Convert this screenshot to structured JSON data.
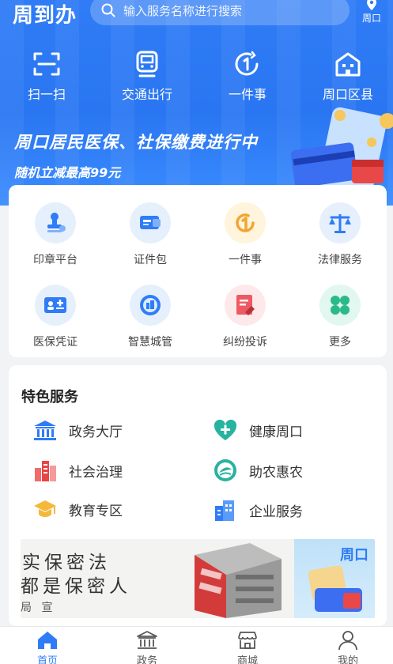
{
  "colors": {
    "primary": "#2f7cf6",
    "hero_bg": "#2a76f2",
    "page_bg": "#f2f3f5"
  },
  "header": {
    "logo": "周到办",
    "search_placeholder": "输入服务名称进行搜索",
    "location": "周口",
    "location_icon": "location-pin-icon",
    "search_icon": "search-icon"
  },
  "quick_actions": [
    {
      "label": "扫一扫",
      "icon": "scan-icon"
    },
    {
      "label": "交通出行",
      "icon": "train-icon"
    },
    {
      "label": "一件事",
      "icon": "one-thing-icon"
    },
    {
      "label": "周口区县",
      "icon": "building-icon"
    }
  ],
  "banner": {
    "title": "周口居民医保、社保缴费进行中",
    "subtitle": "随机立减最高99元"
  },
  "services": [
    {
      "label": "印章平台",
      "icon": "stamp-icon"
    },
    {
      "label": "证件包",
      "icon": "card-wallet-icon"
    },
    {
      "label": "一件事",
      "icon": "one-thing-icon"
    },
    {
      "label": "法律服务",
      "icon": "scales-icon"
    },
    {
      "label": "医保凭证",
      "icon": "medical-card-icon"
    },
    {
      "label": "智慧城管",
      "icon": "city-management-icon"
    },
    {
      "label": "纠纷投诉",
      "icon": "complaint-icon"
    },
    {
      "label": "更多",
      "icon": "more-icon"
    }
  ],
  "featured": {
    "title": "特色服务",
    "items": [
      {
        "label": "政务大厅",
        "icon": "government-hall-icon"
      },
      {
        "label": "健康周口",
        "icon": "health-icon"
      },
      {
        "label": "社会治理",
        "icon": "social-governance-icon"
      },
      {
        "label": "助农惠农",
        "icon": "agriculture-icon"
      },
      {
        "label": "教育专区",
        "icon": "education-icon"
      },
      {
        "label": "企业服务",
        "icon": "enterprise-icon"
      }
    ]
  },
  "ad": {
    "line1": "落实保密法",
    "line2": "人人都是保密人",
    "line3": "局 宣",
    "right_label": "周口"
  },
  "tabbar": [
    {
      "label": "首页",
      "icon": "home-icon",
      "active": true
    },
    {
      "label": "政务",
      "icon": "government-icon",
      "active": false
    },
    {
      "label": "商城",
      "icon": "shop-icon",
      "active": false
    },
    {
      "label": "我的",
      "icon": "user-icon",
      "active": false
    }
  ]
}
